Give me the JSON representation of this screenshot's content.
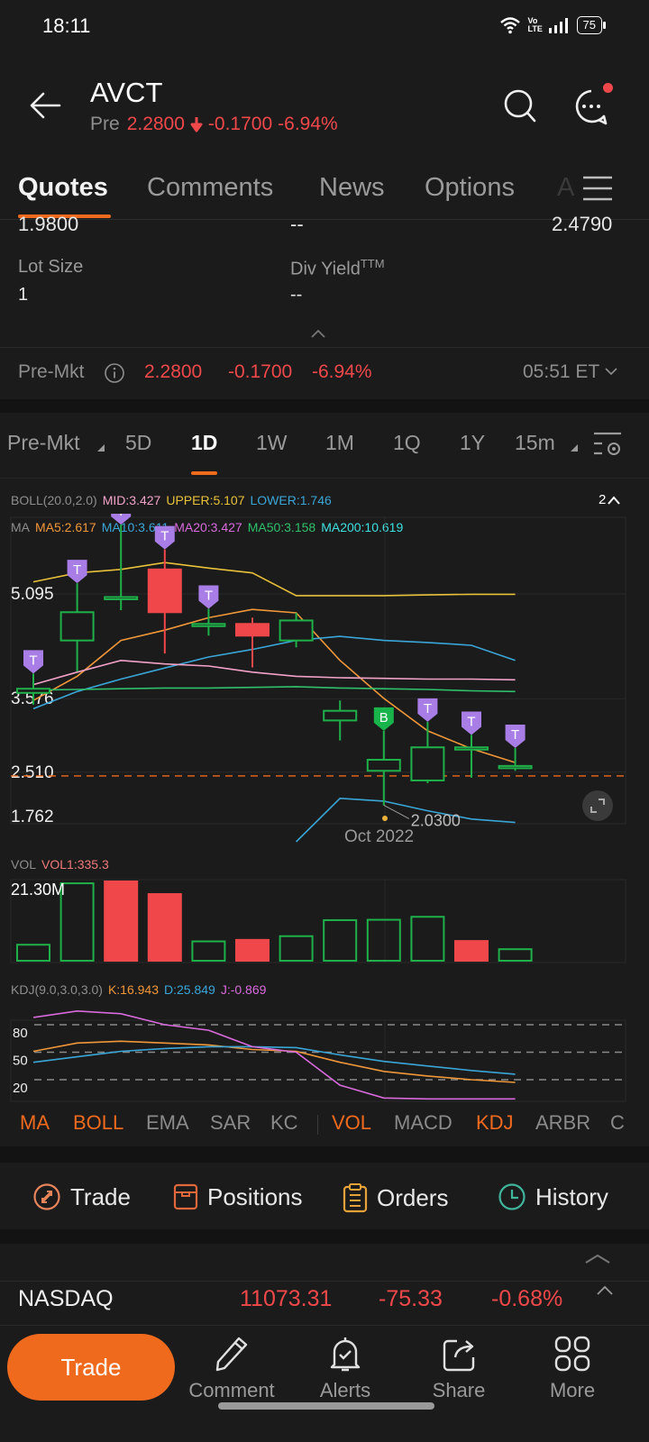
{
  "status_bar": {
    "time": "18:11",
    "network": "Vo LTE",
    "battery": "75"
  },
  "header": {
    "ticker": "AVCT",
    "session_label": "Pre",
    "price": "2.2800",
    "change": "-0.1700",
    "change_pct": "-6.94%"
  },
  "tabs": [
    {
      "label": "Quotes",
      "active": true
    },
    {
      "label": "Comments"
    },
    {
      "label": "News"
    },
    {
      "label": "Options"
    },
    {
      "label": "A"
    }
  ],
  "quote_details": {
    "partial_row": [
      "1.9800",
      "--",
      "2.4790"
    ],
    "lot_size_label": "Lot Size",
    "lot_size_value": "1",
    "div_yield_label": "Div Yield",
    "div_yield_sup": "TTM",
    "div_yield_value": "--"
  },
  "premarket": {
    "label": "Pre-Mkt",
    "price": "2.2800",
    "change": "-0.1700",
    "change_pct": "-6.94%",
    "time": "05:51 ET"
  },
  "period_tabs": [
    {
      "label": "Pre-Mkt"
    },
    {
      "label": "5D"
    },
    {
      "label": "1D",
      "active": true
    },
    {
      "label": "1W"
    },
    {
      "label": "1M"
    },
    {
      "label": "1Q"
    },
    {
      "label": "1Y"
    },
    {
      "label": "15m"
    }
  ],
  "boll_legend": {
    "name": "BOLL(20.0,2.0)",
    "mid": "MID:3.427",
    "upper": "UPPER:5.107",
    "lower": "LOWER:1.746",
    "toggle": "2"
  },
  "ma_legend": {
    "name": "MA",
    "ma5": "MA5:2.617",
    "ma10": "MA10:3.611",
    "ma20": "MA20:3.427",
    "ma50": "MA50:3.158",
    "ma200": "MA200:10.619"
  },
  "vol_legend": {
    "name": "VOL",
    "vol1": "VOL1:335.3",
    "max_label": "21.30M"
  },
  "kdj_legend": {
    "name": "KDJ(9.0,3.0,3.0)",
    "k": "K:16.943",
    "d": "D:25.849",
    "j": "J:-0.869"
  },
  "indicator_tabs": [
    {
      "label": "MA",
      "on": true
    },
    {
      "label": "BOLL",
      "on": true
    },
    {
      "label": "EMA"
    },
    {
      "label": "SAR"
    },
    {
      "label": "KC"
    },
    {
      "label": "VOL",
      "on": true
    },
    {
      "label": "MACD"
    },
    {
      "label": "KDJ",
      "on": true
    },
    {
      "label": "ARBR"
    },
    {
      "label": "C"
    }
  ],
  "actions": [
    {
      "label": "Trade",
      "icon": "trade-icon",
      "color": "#e8845a"
    },
    {
      "label": "Positions",
      "icon": "positions-icon",
      "color": "#e0683a"
    },
    {
      "label": "Orders",
      "icon": "orders-icon",
      "color": "#e8a23a"
    },
    {
      "label": "History",
      "icon": "history-icon",
      "color": "#3fb59a"
    }
  ],
  "index_row": {
    "name": "NASDAQ",
    "value": "11073.31",
    "change": "-75.33",
    "change_pct": "-0.68%"
  },
  "bottom_bar": {
    "trade_label": "Trade",
    "items": [
      {
        "label": "Comment",
        "icon": "pencil-icon"
      },
      {
        "label": "Alerts",
        "icon": "bell-icon"
      },
      {
        "label": "Share",
        "icon": "share-icon"
      },
      {
        "label": "More",
        "icon": "grid-icon"
      }
    ]
  },
  "colors": {
    "up": "#1fb04a",
    "down": "#f0484a",
    "accent": "#f06a1e",
    "marker": "#a97de6"
  },
  "chart_data": [
    {
      "type": "candlestick",
      "title": "AVCT 1D",
      "xlabel": "Oct 2022",
      "y_ticks": [
        5.095,
        3.576,
        2.51,
        1.762
      ],
      "ylim": [
        1.762,
        6.9
      ],
      "current_price_line": 2.28,
      "low_annotation": "2.0300",
      "candles": [
        {
          "o": 3.66,
          "c": 3.72,
          "h": 3.94,
          "l": 3.49,
          "marker": "T"
        },
        {
          "o": 4.42,
          "c": 4.83,
          "h": 5.25,
          "l": 3.97,
          "marker": "T"
        },
        {
          "o": 5.05,
          "c": 5.05,
          "h": 6.1,
          "l": 4.86,
          "marker": "T"
        },
        {
          "o": 5.45,
          "c": 4.83,
          "h": 5.74,
          "l": 4.23,
          "marker": "T"
        },
        {
          "o": 4.66,
          "c": 4.66,
          "h": 4.88,
          "l": 4.49,
          "marker": "T"
        },
        {
          "o": 4.66,
          "c": 4.49,
          "h": 4.75,
          "l": 4.03,
          "marker": null
        },
        {
          "o": 4.42,
          "c": 4.71,
          "h": 4.82,
          "l": 4.32,
          "marker": null
        },
        {
          "o": 3.26,
          "c": 3.4,
          "h": 3.55,
          "l": 2.97,
          "marker": null
        },
        {
          "o": 2.53,
          "c": 2.69,
          "h": 3.11,
          "l": 2.03,
          "marker": "B"
        },
        {
          "o": 2.39,
          "c": 2.87,
          "h": 3.24,
          "l": 2.35,
          "marker": "T"
        },
        {
          "o": 2.87,
          "c": 2.87,
          "h": 3.05,
          "l": 2.43,
          "marker": "T"
        },
        {
          "o": 2.59,
          "c": 2.6,
          "h": 2.86,
          "l": 2.53,
          "marker": "T"
        }
      ],
      "series": [
        {
          "name": "BOLL UPPER",
          "color": "#e9c23a",
          "values": [
            5.27,
            5.4,
            5.45,
            5.55,
            5.47,
            5.4,
            5.07,
            5.07,
            5.07,
            5.08,
            5.09,
            5.09
          ]
        },
        {
          "name": "MA5",
          "color": "#f0973a",
          "values": [
            3.55,
            3.9,
            4.42,
            4.57,
            4.75,
            4.87,
            4.82,
            4.13,
            3.58,
            3.11,
            2.85,
            2.65
          ]
        },
        {
          "name": "MA10",
          "color": "#3aa6d8",
          "values": [
            3.43,
            3.68,
            3.86,
            4.02,
            4.18,
            4.29,
            4.42,
            4.48,
            4.42,
            4.39,
            4.35,
            4.13
          ]
        },
        {
          "name": "MA20",
          "color": "#f3a3c8",
          "values": [
            3.78,
            3.96,
            4.13,
            4.08,
            4.05,
            3.96,
            3.9,
            3.88,
            3.87,
            3.86,
            3.86,
            3.85
          ]
        },
        {
          "name": "MA50",
          "color": "#2fc06c",
          "values": [
            3.7,
            3.71,
            3.72,
            3.73,
            3.73,
            3.74,
            3.75,
            3.73,
            3.72,
            3.71,
            3.69,
            3.68
          ]
        },
        {
          "name": "BOLL LOWER",
          "color": "#3aa6d8",
          "values": [
            null,
            null,
            null,
            null,
            null,
            null,
            1.5,
            2.13,
            2.09,
            1.95,
            1.83,
            1.78
          ]
        }
      ]
    },
    {
      "type": "bar",
      "title": "VOL",
      "max_label": "21.30M",
      "values": [
        4.3,
        20.8,
        21.3,
        17.9,
        5.2,
        5.6,
        6.6,
        10.9,
        11.0,
        11.8,
        5.3,
        3.1
      ],
      "directions": [
        "up",
        "up",
        "down",
        "down",
        "up",
        "down",
        "up",
        "up",
        "up",
        "up",
        "down",
        "up"
      ],
      "unit": "M"
    },
    {
      "type": "line",
      "title": "KDJ(9.0,3.0,3.0)",
      "y_ticks": [
        80,
        50,
        20
      ],
      "ylim": [
        -10,
        110
      ],
      "series": [
        {
          "name": "K",
          "color": "#f0973a",
          "values": [
            51,
            60,
            62,
            60,
            58,
            53,
            51,
            39,
            29,
            24,
            20,
            17
          ]
        },
        {
          "name": "D",
          "color": "#3aa6d8",
          "values": [
            39,
            45,
            51,
            54,
            56,
            56,
            55,
            47,
            40,
            35,
            30,
            26
          ]
        },
        {
          "name": "J",
          "color": "#d86adc",
          "values": [
            88,
            95,
            92,
            80,
            74,
            56,
            50,
            14,
            0,
            -1,
            -1,
            -1
          ]
        }
      ]
    }
  ]
}
